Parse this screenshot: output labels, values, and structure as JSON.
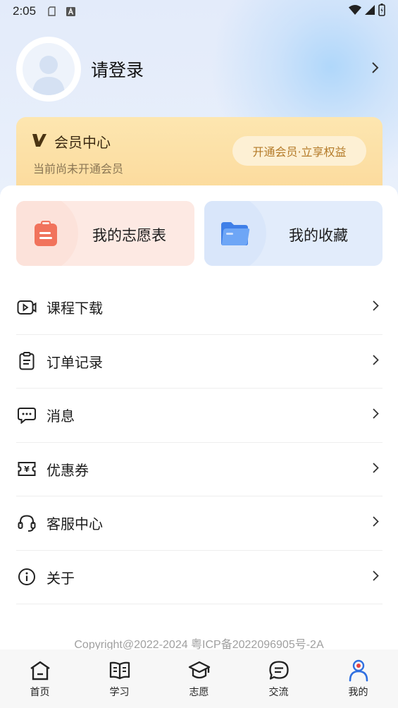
{
  "status_bar": {
    "time": "2:05"
  },
  "profile": {
    "login_text": "请登录"
  },
  "vip": {
    "title": "会员中心",
    "subtitle": "当前尚未开通会员",
    "button": "开通会员·立享权益"
  },
  "quick": {
    "wish_label": "我的志愿表",
    "fav_label": "我的收藏"
  },
  "menu": [
    {
      "label": "课程下载",
      "icon": "video-icon"
    },
    {
      "label": "订单记录",
      "icon": "clipboard-icon"
    },
    {
      "label": "消息",
      "icon": "message-icon"
    },
    {
      "label": "优惠券",
      "icon": "coupon-icon"
    },
    {
      "label": "客服中心",
      "icon": "headset-icon"
    },
    {
      "label": "关于",
      "icon": "info-icon"
    }
  ],
  "footer": {
    "copyright": "Copyright@2022-2024 粤ICP备2022096905号-2A"
  },
  "tabs": [
    {
      "label": "首页",
      "icon": "home-icon"
    },
    {
      "label": "学习",
      "icon": "book-icon"
    },
    {
      "label": "志愿",
      "icon": "graduation-cap-icon"
    },
    {
      "label": "交流",
      "icon": "chat-icon"
    },
    {
      "label": "我的",
      "icon": "user-icon",
      "active": true
    }
  ],
  "colors": {
    "accent": "#2f6fe0",
    "active_tab_head": "#e8423f",
    "vip_button_text": "#b47a28",
    "wish_icon": "#f1735c",
    "fav_icon": "#4d8ef0"
  }
}
